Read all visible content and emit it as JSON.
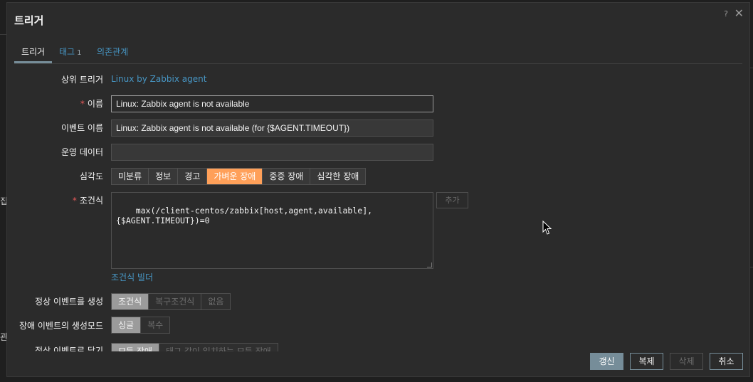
{
  "background": {
    "left_fragments": [
      "집",
      "관"
    ]
  },
  "dialog": {
    "title": "트리거",
    "help": "?",
    "close": "✕"
  },
  "tabs": [
    {
      "label": "트리거"
    },
    {
      "label": "태그",
      "count": "1"
    },
    {
      "label": "의존관계"
    }
  ],
  "form": {
    "parent_trigger": {
      "label": "상위 트리거",
      "value": "Linux by Zabbix agent"
    },
    "name": {
      "label": "이름",
      "value": "Linux: Zabbix agent is not available"
    },
    "event_name": {
      "label": "이벤트 이름",
      "value": "Linux: Zabbix agent is not available (for {$AGENT.TIMEOUT})"
    },
    "opdata": {
      "label": "운영 데이터",
      "value": ""
    },
    "severity": {
      "label": "심각도",
      "options": [
        "미분류",
        "정보",
        "경고",
        "가벼운 장애",
        "중증 장애",
        "심각한 장애"
      ],
      "selected": "가벼운 장애"
    },
    "expression": {
      "label": "조건식",
      "value": "max(/client-centos/zabbix[host,agent,available],\n{$AGENT.TIMEOUT})=0",
      "add_label": "추가",
      "builder_link": "조건식 빌더"
    },
    "ok_event": {
      "label": "정상 이벤트를 생성",
      "options": [
        "조건식",
        "복구조건식",
        "없음"
      ],
      "selected": "조건식"
    },
    "problem_mode": {
      "label": "장애 이벤트의 생성모드",
      "options": [
        "싱글",
        "복수"
      ],
      "selected": "싱글"
    },
    "ok_close": {
      "label": "정상 이벤트로 닫기",
      "options": [
        "모든 장애",
        "태그 값이 일치하는 모든 장애"
      ],
      "selected": "모든 장애"
    }
  },
  "footer": {
    "update": "갱신",
    "clone": "복제",
    "delete": "삭제",
    "cancel": "취소"
  },
  "colors": {
    "accent_orange": "#ffa059",
    "link_blue": "#4796c4",
    "button_blue_grey": "#768d99",
    "required_red": "#e45959"
  }
}
